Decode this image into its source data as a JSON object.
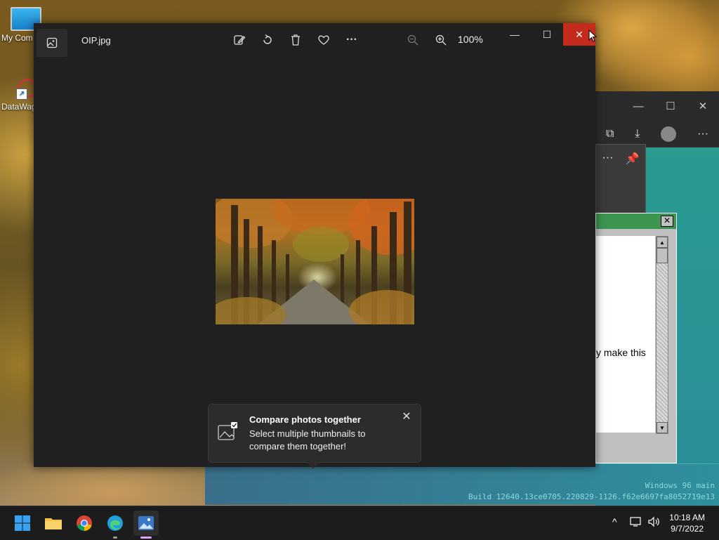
{
  "desktop": {
    "icons": [
      {
        "label": "My Com"
      },
      {
        "label": "DataWag"
      }
    ],
    "w96_footer": {
      "line1": "Windows 96 main",
      "line2": "Build 12640.13ce0705.220829-1126.f62e6697fa8052719e13"
    }
  },
  "bg_dialog": {
    "visible_text": "y make this"
  },
  "photos": {
    "file_name": "OIP.jpg",
    "zoom": "100%",
    "toolbar_icons": [
      "edit-icon",
      "rotate-icon",
      "delete-icon",
      "favorite-icon",
      "more-icon"
    ],
    "zoom_icons": [
      "zoom-out-icon",
      "zoom-in-icon"
    ],
    "window_controls": [
      "minimize",
      "maximize",
      "close"
    ]
  },
  "tip": {
    "title": "Compare photos together",
    "body": "Select multiple thumbnails to compare them together!"
  },
  "taskbar": {
    "apps": [
      "start",
      "file-explorer",
      "chrome",
      "edge",
      "photos"
    ],
    "time": "10:18 AM",
    "date": "9/7/2022"
  }
}
